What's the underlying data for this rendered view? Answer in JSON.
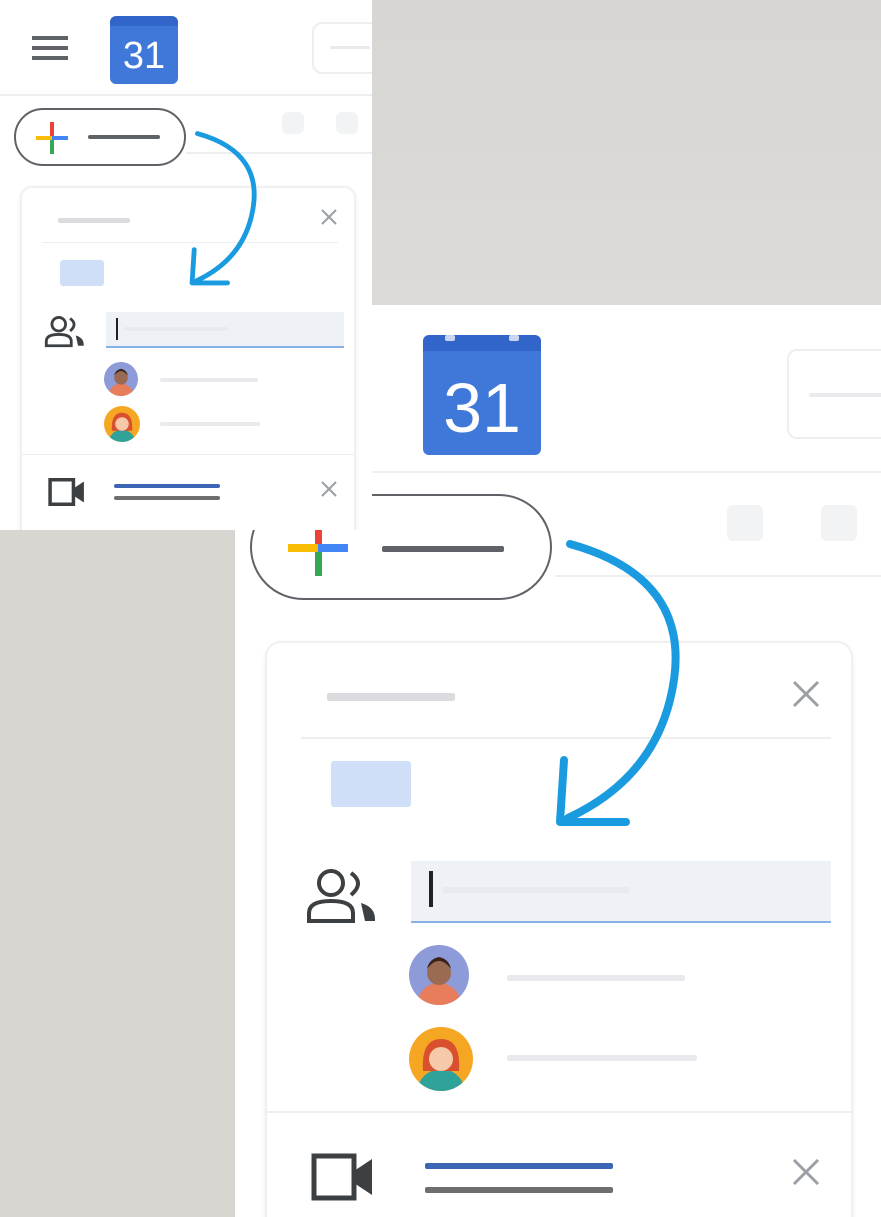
{
  "small_view": {
    "calendar_icon": {
      "number": "31",
      "icon": "calendar-icon"
    },
    "menu_icon": "hamburger-menu-icon",
    "create_button_icon": "plus-icon",
    "close_icon": "close-icon",
    "guests_icon": "people-icon",
    "video_icon": "video-camera-icon"
  },
  "large_view": {
    "calendar_icon": {
      "number": "31",
      "icon": "calendar-icon"
    },
    "create_button_icon": "plus-icon",
    "close_icon": "close-icon",
    "guests_icon": "people-icon",
    "video_icon": "video-camera-icon"
  },
  "colors": {
    "calendar_blue": "#3f78d9",
    "arrow": "#1a9be0",
    "plus_red": "#ea4335",
    "plus_blue": "#4285f4",
    "plus_green": "#34a853",
    "plus_yellow": "#fbbc05"
  }
}
